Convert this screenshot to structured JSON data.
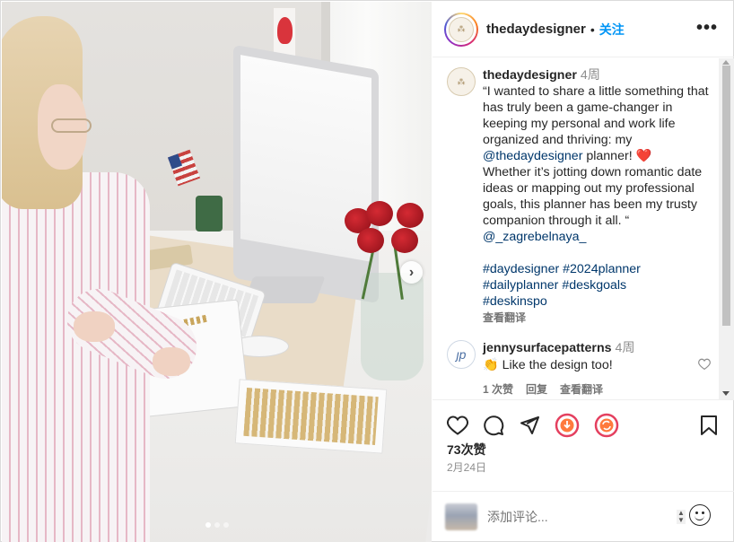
{
  "post": {
    "username": "thedaydesigner",
    "separator": "•",
    "follow_label": "关注",
    "more_label": "•••"
  },
  "caption": {
    "username": "thedaydesigner",
    "time": "4周",
    "text_1": "“I wanted to share a little something that has truly been a game-changer in keeping my personal and work life organized and thriving: my ",
    "mention_1": "@thedaydesigner",
    "text_2": " planner! ",
    "emoji": "❤️",
    "text_3": " Whether it’s jotting down romantic date ideas or mapping out my professional goals, this planner has been my trusty companion through it all. “ ",
    "mention_2": "@_zagrebelnaya_",
    "hashtags_line1": "#daydesigner #2024planner",
    "hashtags_line2": "#dailyplanner #deskgoals",
    "hashtags_line3": "#deskinspo",
    "translate": "查看翻译"
  },
  "comment": {
    "username": "jennysurfacepatterns",
    "time": "4周",
    "emoji": "👏",
    "text": " Like the design too!",
    "likes": "1 次赞",
    "reply": "回复",
    "translate": "查看翻译",
    "avatar_glyph": "ȷp"
  },
  "stats": {
    "likes": "73次赞",
    "date": "2月24日"
  },
  "composer": {
    "placeholder": "添加评论..."
  },
  "carousel": {
    "next_glyph": "›",
    "slide_count": 3,
    "active_slide": 1
  },
  "colors": {
    "accent": "#0095f6",
    "link": "#00376b"
  },
  "icons": [
    "heart-icon",
    "comment-icon",
    "share-icon",
    "download-icon",
    "sync-icon",
    "bookmark-icon",
    "emoji-icon",
    "chevron-right-icon"
  ]
}
